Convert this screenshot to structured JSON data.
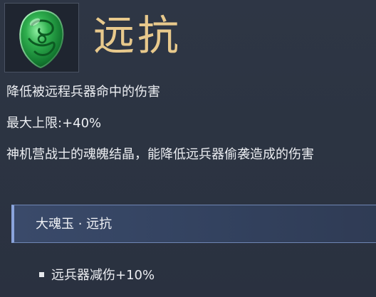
{
  "item": {
    "icon": "jade-soul-gem-icon",
    "name": "远抗",
    "effect": "降低被远程兵器命中的伤害",
    "max_limit": "最大上限:+40%",
    "description": "神机营战士的魂魄结晶，能降低远兵器偷袭造成的伤害"
  },
  "set": {
    "header": "大魂玉 · 远抗",
    "bonuses": [
      {
        "text": "远兵器减伤+10%"
      }
    ]
  },
  "colors": {
    "title": "#e8c98c",
    "jade": "#2fae4e",
    "header_accent": "#8aa4dc"
  }
}
